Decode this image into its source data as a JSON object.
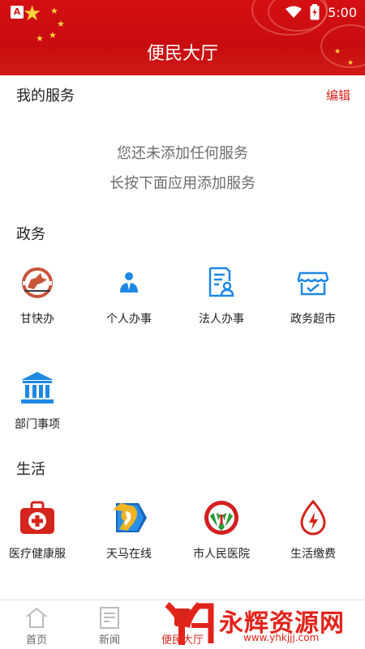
{
  "status_bar": {
    "time": "5:00",
    "left_icon_letter": "A"
  },
  "header": {
    "title": "便民大厅"
  },
  "my_services": {
    "title": "我的服务",
    "edit_label": "编辑",
    "empty_line1": "您还未添加任何服务",
    "empty_line2": "长按下面应用添加服务"
  },
  "government": {
    "title": "政务",
    "items": [
      {
        "label": "甘快办",
        "icon": "gan-kuai-ban-logo-icon"
      },
      {
        "label": "个人办事",
        "icon": "person-icon"
      },
      {
        "label": "法人办事",
        "icon": "legal-person-document-icon"
      },
      {
        "label": "政务超市",
        "icon": "store-icon"
      },
      {
        "label": "部门事项",
        "icon": "government-building-icon"
      }
    ]
  },
  "life": {
    "title": "生活",
    "items": [
      {
        "label": "医疗健康服",
        "icon": "medical-kit-icon"
      },
      {
        "label": "天马在线",
        "icon": "tianma-logo-icon"
      },
      {
        "label": "市人民医院",
        "icon": "hospital-logo-icon"
      },
      {
        "label": "生活缴费",
        "icon": "utility-payment-icon"
      }
    ]
  },
  "tabbar": {
    "tabs": [
      {
        "label": "首页",
        "icon": "home-icon"
      },
      {
        "label": "新闻",
        "icon": "news-icon"
      },
      {
        "label": "便民大厅",
        "icon": "service-hall-icon",
        "active": true
      },
      {
        "label": "",
        "icon": ""
      },
      {
        "label": "",
        "icon": ""
      }
    ]
  },
  "watermark": {
    "text": "永辉资源网",
    "url": "www.yhkjjj.com"
  },
  "colors": {
    "header_red": "#d40f14",
    "accent_red": "#d5241c",
    "icon_blue": "#1e88e5"
  }
}
